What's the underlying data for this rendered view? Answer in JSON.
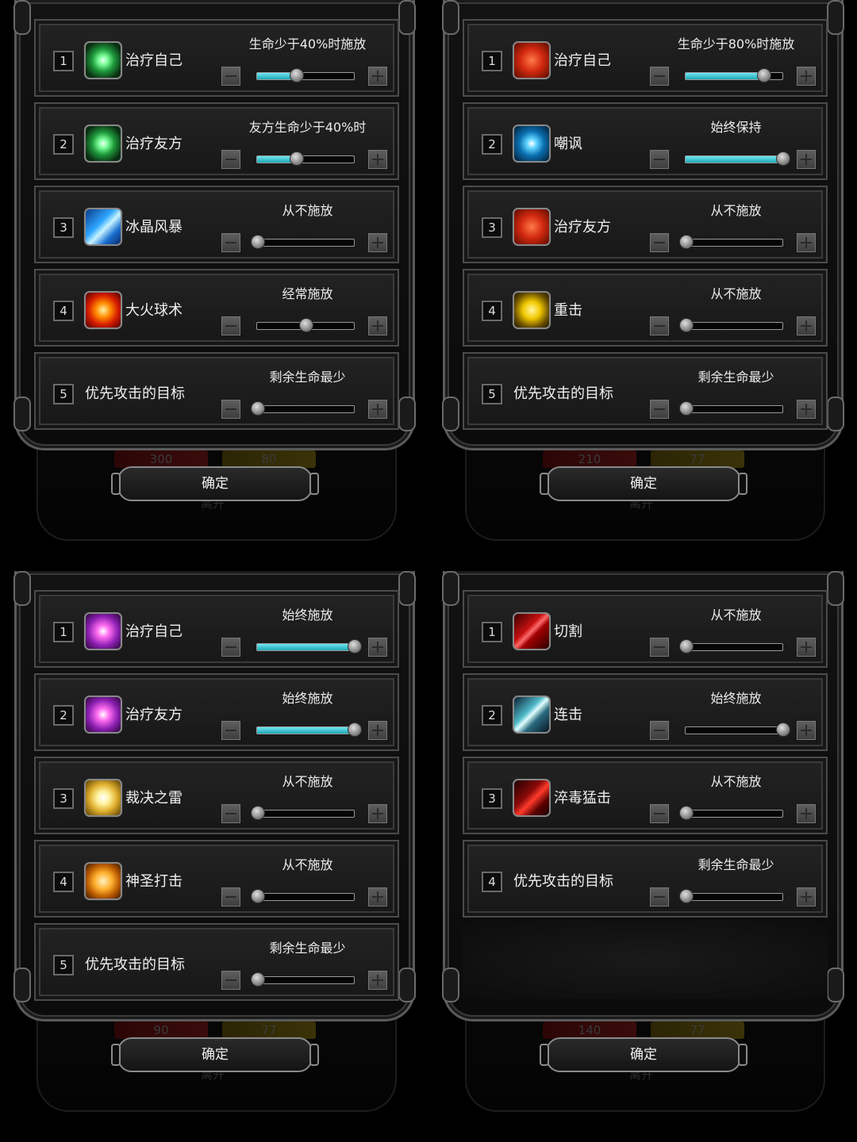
{
  "panels": [
    {
      "ghost": {
        "hp": "300",
        "mp": "80",
        "text": "离开"
      },
      "confirm_label": "确定",
      "rows": [
        {
          "num": "1",
          "icon": "green-crystal-heal-icon",
          "name": "治疗自己",
          "status": "生命少于40%时施放",
          "level": 0.4,
          "filled": true
        },
        {
          "num": "2",
          "icon": "green-crystal-heal-icon",
          "name": "治疗友方",
          "status": "友方生命少于40%时",
          "level": 0.4,
          "filled": true
        },
        {
          "num": "3",
          "icon": "ice-storm-icon",
          "name": "冰晶风暴",
          "status": "从不施放",
          "level": 0.0,
          "filled": false
        },
        {
          "num": "4",
          "icon": "fireball-icon",
          "name": "大火球术",
          "status": "经常施放",
          "level": 0.5,
          "filled": false
        },
        {
          "num": "5",
          "icon": "",
          "name": "优先攻击的目标",
          "status": "剩余生命最少",
          "level": 0.0,
          "filled": false
        }
      ]
    },
    {
      "ghost": {
        "hp": "210",
        "mp": "77",
        "text": "离开"
      },
      "confirm_label": "确定",
      "rows": [
        {
          "num": "1",
          "icon": "red-cross-heal-icon",
          "name": "治疗自己",
          "status": "生命少于80%时施放",
          "level": 0.8,
          "filled": true
        },
        {
          "num": "2",
          "icon": "eye-taunt-icon",
          "name": "嘲讽",
          "status": "始终保持",
          "level": 1.0,
          "filled": true
        },
        {
          "num": "3",
          "icon": "red-cross-heal-icon",
          "name": "治疗友方",
          "status": "从不施放",
          "level": 0.0,
          "filled": false
        },
        {
          "num": "4",
          "icon": "fist-strike-icon",
          "name": "重击",
          "status": "从不施放",
          "level": 0.0,
          "filled": false
        },
        {
          "num": "5",
          "icon": "",
          "name": "优先攻击的目标",
          "status": "剩余生命最少",
          "level": 0.0,
          "filled": false
        }
      ]
    },
    {
      "ghost": {
        "hp": "90",
        "mp": "77",
        "text": "离开"
      },
      "confirm_label": "确定",
      "rows": [
        {
          "num": "1",
          "icon": "purple-rune-heal-icon",
          "name": "治疗自己",
          "status": "始终施放",
          "level": 1.0,
          "filled": true
        },
        {
          "num": "2",
          "icon": "purple-rune-heal-icon",
          "name": "治疗友方",
          "status": "始终施放",
          "level": 1.0,
          "filled": true
        },
        {
          "num": "3",
          "icon": "holy-burst-icon",
          "name": "裁决之雷",
          "status": "从不施放",
          "level": 0.0,
          "filled": false
        },
        {
          "num": "4",
          "icon": "holy-strike-icon",
          "name": "神圣打击",
          "status": "从不施放",
          "level": 0.0,
          "filled": false
        },
        {
          "num": "5",
          "icon": "",
          "name": "优先攻击的目标",
          "status": "剩余生命最少",
          "level": 0.0,
          "filled": false
        }
      ]
    },
    {
      "ghost": {
        "hp": "140",
        "mp": "77",
        "text": "离开"
      },
      "confirm_label": "确定",
      "rows": [
        {
          "num": "1",
          "icon": "slash-cut-icon",
          "name": "切割",
          "status": "从不施放",
          "level": 0.0,
          "filled": false
        },
        {
          "num": "2",
          "icon": "combo-strike-icon",
          "name": "连击",
          "status": "始终施放",
          "level": 1.0,
          "filled": false
        },
        {
          "num": "3",
          "icon": "poison-strike-icon",
          "name": "淬毒猛击",
          "status": "从不施放",
          "level": 0.0,
          "filled": false
        },
        {
          "num": "4",
          "icon": "",
          "name": "优先攻击的目标",
          "status": "剩余生命最少",
          "level": 0.0,
          "filled": false
        }
      ]
    }
  ],
  "colors": {
    "slider_fill": "#2bb8c4",
    "frame": "#5a5a5a"
  }
}
